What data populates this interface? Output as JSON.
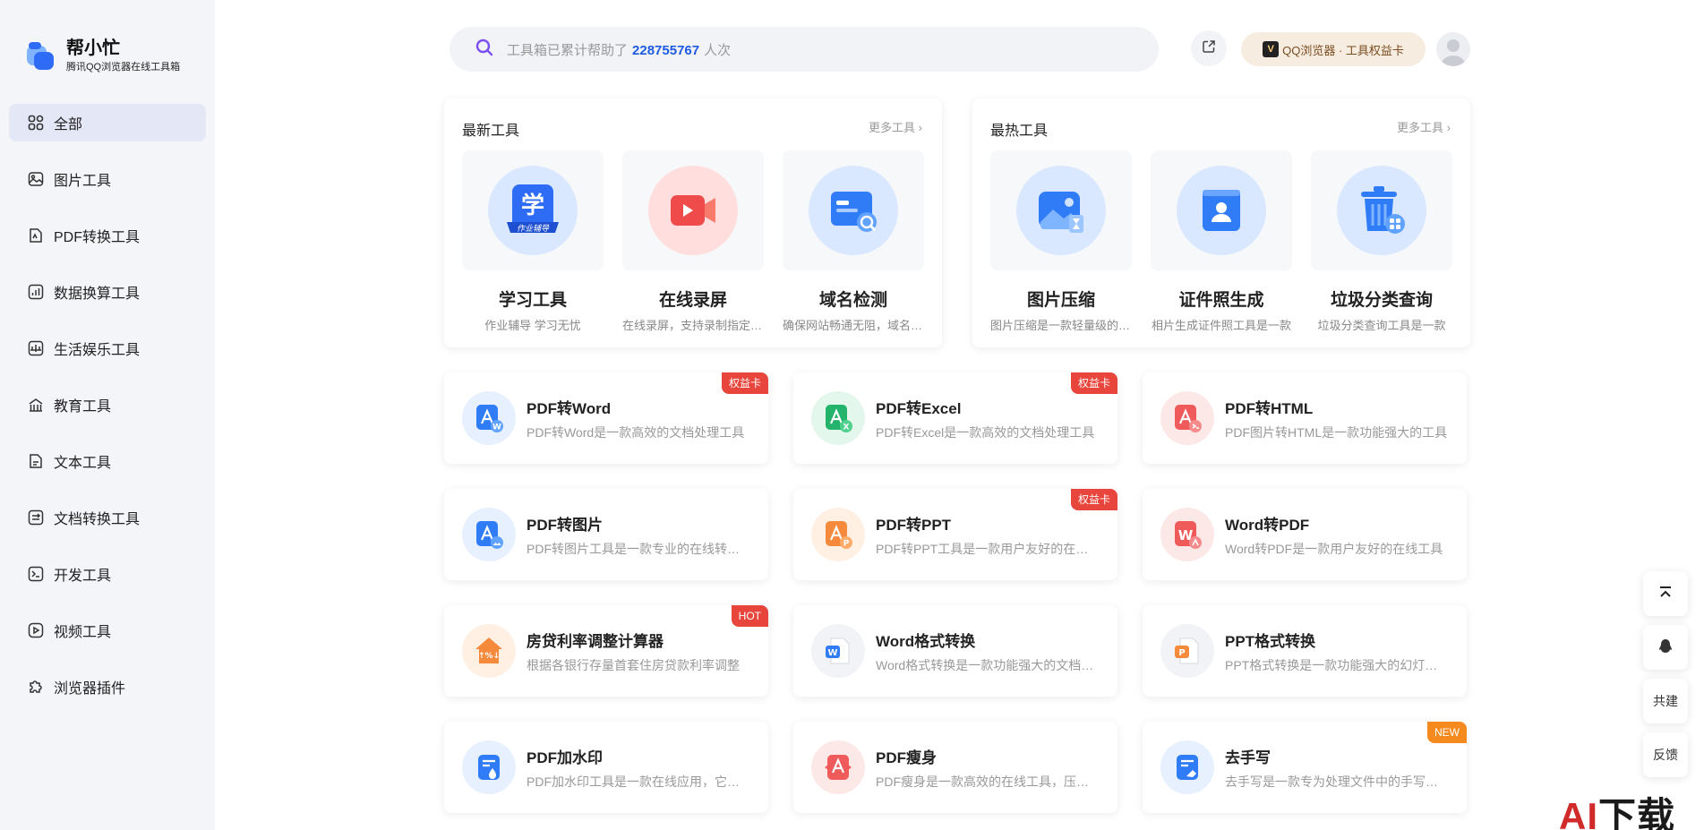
{
  "brand": {
    "name": "帮小忙",
    "subtitle": "腾讯QQ浏览器在线工具箱"
  },
  "sidebar": {
    "items": [
      {
        "label": "全部",
        "icon": "grid-icon",
        "active": true
      },
      {
        "label": "图片工具",
        "icon": "image-icon"
      },
      {
        "label": "PDF转换工具",
        "icon": "pdf-doc-icon"
      },
      {
        "label": "数据换算工具",
        "icon": "chart-icon"
      },
      {
        "label": "生活娱乐工具",
        "icon": "entertainment-icon"
      },
      {
        "label": "教育工具",
        "icon": "school-icon"
      },
      {
        "label": "文本工具",
        "icon": "text-doc-icon"
      },
      {
        "label": "文档转换工具",
        "icon": "doc-convert-icon"
      },
      {
        "label": "开发工具",
        "icon": "terminal-icon"
      },
      {
        "label": "视频工具",
        "icon": "video-icon"
      },
      {
        "label": "浏览器插件",
        "icon": "puzzle-icon"
      }
    ]
  },
  "header": {
    "search_prefix": "工具箱已累计帮助了",
    "search_count": "228755767",
    "search_suffix": "人次",
    "qq_pill": "QQ浏览器 · 工具权益卡",
    "qq_icon_letter": "V"
  },
  "latest": {
    "title": "最新工具",
    "more": "更多工具 ›",
    "items": [
      {
        "name": "学习工具",
        "desc": "作业辅导 学习无忧",
        "color": "#2f6cf6",
        "icon_text": "学",
        "icon_sub": "作业辅导"
      },
      {
        "name": "在线录屏",
        "desc": "在线录屏，支持录制指定区域",
        "color": "#f04b4b"
      },
      {
        "name": "域名检测",
        "desc": "确保网站畅通无阻，域名检测",
        "color": "#2f7cf6"
      }
    ]
  },
  "hottest": {
    "title": "最热工具",
    "more": "更多工具 ›",
    "items": [
      {
        "name": "图片压缩",
        "desc": "图片压缩是一款轻量级的工具",
        "color": "#2f7cf6"
      },
      {
        "name": "证件照生成",
        "desc": "相片生成证件照工具是一款",
        "color": "#2f7cf6"
      },
      {
        "name": "垃圾分类查询",
        "desc": "垃圾分类查询工具是一款",
        "color": "#2f7cf6"
      }
    ]
  },
  "tools": [
    {
      "title": "PDF转Word",
      "desc": "PDF转Word是一款高效的文档处理工具",
      "badge": "权益卡",
      "badge_color": "#e8453c",
      "color": "#2f7cf6",
      "bg": "#e6f0ff"
    },
    {
      "title": "PDF转Excel",
      "desc": "PDF转Excel是一款高效的文档处理工具",
      "badge": "权益卡",
      "badge_color": "#e8453c",
      "color": "#24b36b",
      "bg": "#e3f7ec"
    },
    {
      "title": "PDF转HTML",
      "desc": "PDF图片转HTML是一款功能强大的工具",
      "badge": "",
      "color": "#ef5a5a",
      "bg": "#fde8e8"
    },
    {
      "title": "PDF转图片",
      "desc": "PDF转图片工具是一款专业的在线转换工具",
      "badge": "",
      "color": "#2f7cf6",
      "bg": "#e6f0ff"
    },
    {
      "title": "PDF转PPT",
      "desc": "PDF转PPT工具是一款用户友好的在线工具",
      "badge": "权益卡",
      "badge_color": "#e8453c",
      "color": "#f58a3c",
      "bg": "#fff0e3"
    },
    {
      "title": "Word转PDF",
      "desc": "Word转PDF是一款用户友好的在线工具",
      "badge": "",
      "color": "#ef5a5a",
      "bg": "#fde8e8"
    },
    {
      "title": "房贷利率调整计算器",
      "desc": "根据各银行存量首套住房贷款利率调整",
      "badge": "HOT",
      "badge_color": "#e8453c",
      "color": "#f58a3c",
      "bg": "#fff0e3"
    },
    {
      "title": "Word格式转换",
      "desc": "Word格式转换是一款功能强大的文档工具",
      "badge": "",
      "color": "#2f7cf6",
      "bg": "#f2f3f6"
    },
    {
      "title": "PPT格式转换",
      "desc": "PPT格式转换是一款功能强大的幻灯片工具",
      "badge": "",
      "color": "#f58a3c",
      "bg": "#f2f3f6"
    },
    {
      "title": "PDF加水印",
      "desc": "PDF加水印工具是一款在线应用，它可以",
      "badge": "",
      "color": "#2f7cf6",
      "bg": "#e6f0ff"
    },
    {
      "title": "PDF瘦身",
      "desc": "PDF瘦身是一款高效的在线工具，压缩文件",
      "badge": "",
      "color": "#ef5a5a",
      "bg": "#fde8e8"
    },
    {
      "title": "去手写",
      "desc": "去手写是一款专为处理文件中的手写痕迹",
      "badge": "NEW",
      "badge_color": "#f58a1f",
      "color": "#2f7cf6",
      "bg": "#e6f0ff"
    }
  ],
  "floating": {
    "top_label": "",
    "cobuild": "共建",
    "feedback": "反馈"
  },
  "watermark": {
    "a": "AI",
    "rest": "下载"
  }
}
